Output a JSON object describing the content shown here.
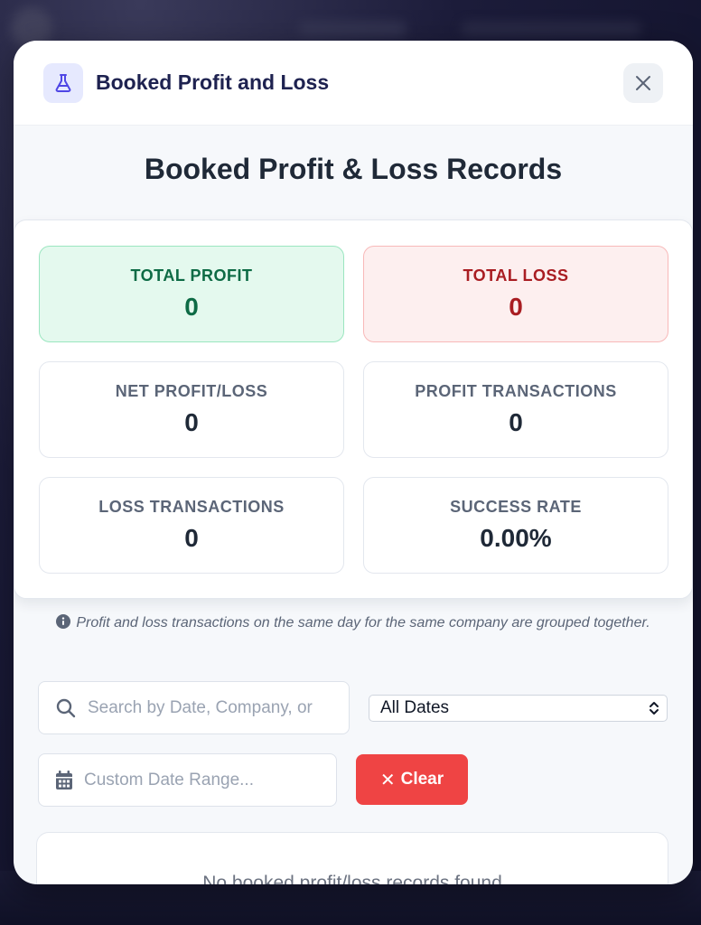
{
  "modal": {
    "title": "Booked Profit and Loss",
    "header_icon": "flask-icon",
    "close_icon": "close-icon"
  },
  "section_title": "Booked Profit & Loss Records",
  "stats": {
    "total_profit": {
      "label": "TOTAL PROFIT",
      "value": "0"
    },
    "total_loss": {
      "label": "TOTAL LOSS",
      "value": "0"
    },
    "net": {
      "label": "NET PROFIT/LOSS",
      "value": "0"
    },
    "profit_tx": {
      "label": "PROFIT TRANSACTIONS",
      "value": "0"
    },
    "loss_tx": {
      "label": "LOSS TRANSACTIONS",
      "value": "0"
    },
    "success_rate": {
      "label": "SUCCESS RATE",
      "value": "0.00%"
    }
  },
  "note": "Profit and loss transactions on the same day for the same company are grouped together.",
  "filters": {
    "search_placeholder": "Search by Date, Company, or",
    "date_select": {
      "selected": "All Dates"
    },
    "custom_range_placeholder": "Custom Date Range...",
    "clear_label": "Clear"
  },
  "records": {
    "empty_message": "No booked profit/loss records found"
  },
  "colors": {
    "profit": "#0d6b45",
    "loss": "#a91d22",
    "accent": "#ef4444",
    "title": "#1e2250"
  }
}
